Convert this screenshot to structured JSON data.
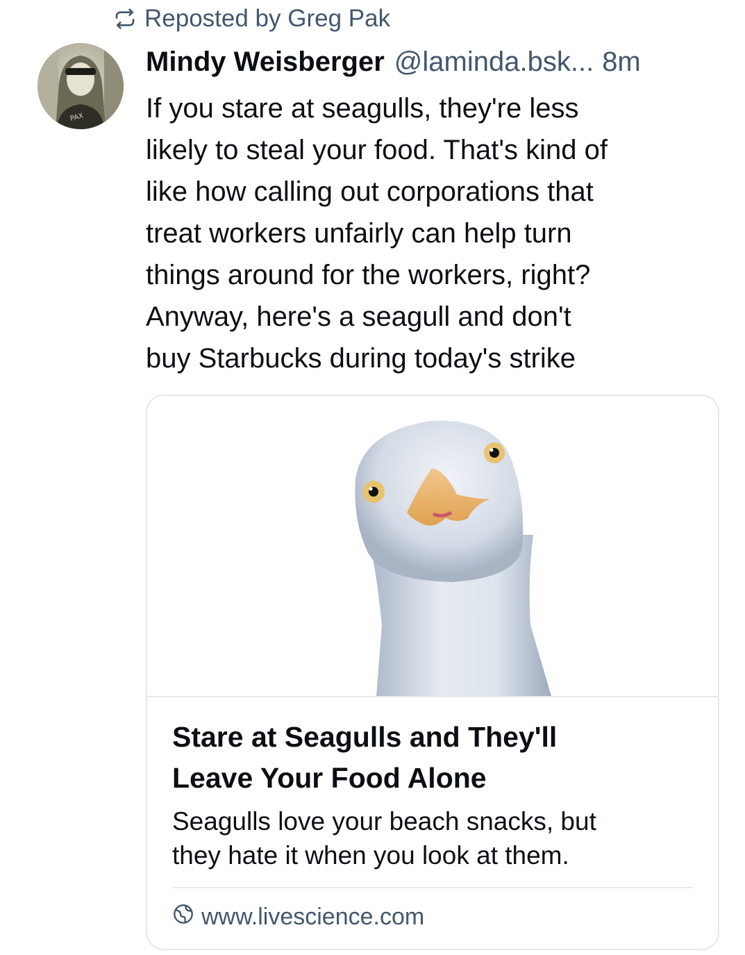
{
  "repost": {
    "icon": "repost-icon",
    "text": "Reposted by Greg Pak"
  },
  "author": {
    "display_name": "Mindy Weisberger",
    "handle": "@laminda.bsk...",
    "separator": "",
    "timestamp": "8m",
    "avatar": "avatar"
  },
  "post": {
    "lines": [
      "If you stare at seagulls, they're less",
      "likely to steal your food. That's kind of",
      "like how calling out corporations that",
      "treat workers unfairly can help turn",
      "things around for the workers, right?",
      "Anyway, here's a seagull and don't",
      "buy Starbucks during today's strike"
    ]
  },
  "link_card": {
    "image": "seagull-image",
    "title_lines": [
      "Stare at Seagulls and They'll",
      "Leave Your Food Alone"
    ],
    "description_lines": [
      "Seagulls love your beach snacks, but",
      "they hate it when you look at them."
    ],
    "domain_icon": "globe-icon",
    "domain": "www.livescience.com"
  },
  "colors": {
    "text_primary": "#0b0f14",
    "text_secondary": "#42576c",
    "border": "#e4e8ec"
  }
}
